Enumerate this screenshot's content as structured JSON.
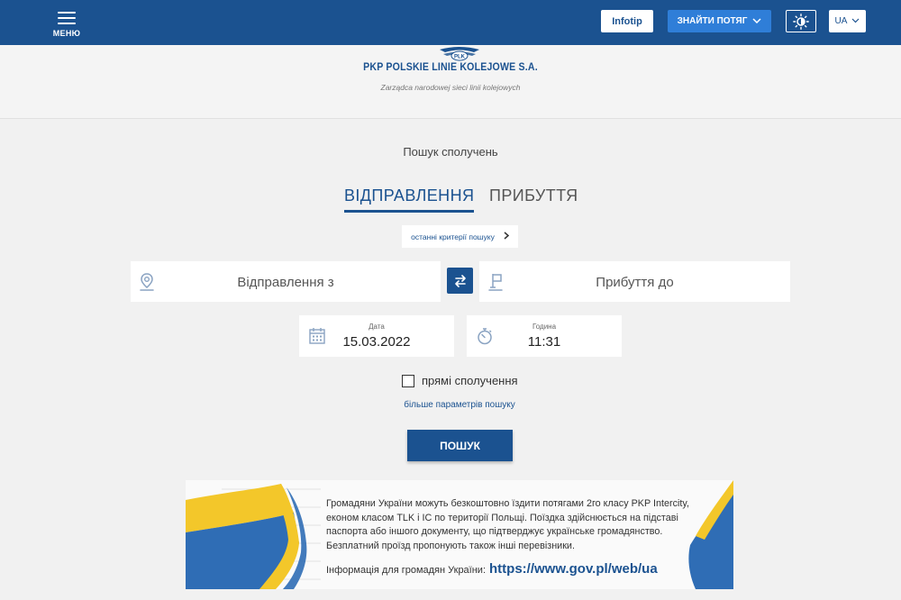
{
  "header": {
    "menu_label": "МЕНЮ",
    "infotip_label": "Infotip",
    "find_train_label": "ЗНАЙТИ ПОТЯГ",
    "lang_label": "UA"
  },
  "logo": {
    "mark_text": "PLK",
    "company_name": "PKP POLSKIE LINIE KOLEJOWE S.A.",
    "tagline": "Zarządca narodowej sieci linii kolejowych"
  },
  "search": {
    "title": "Пошук сполучень",
    "tabs": [
      {
        "label": "ВІДПРАВЛЕННЯ",
        "active": true
      },
      {
        "label": "ПРИБУТТЯ",
        "active": false
      }
    ],
    "recent_criteria_label": "останні критерії пошуку",
    "from_placeholder": "Відправлення з",
    "to_placeholder": "Прибуття до",
    "date_label": "Дата",
    "date_value": "15.03.2022",
    "time_label": "Година",
    "time_value": "11:31",
    "direct_label": "прямі сполучення",
    "direct_checked": false,
    "more_params_label": "більше параметрів пошуку",
    "search_button_label": "ПОШУК"
  },
  "banner": {
    "text": "Громадяни України можуть безкоштовно їздити потягами 2го класу PKP Intercity, економ класом TLK і IC по території Польщі. Поїздка здійснюється на підставі паспорта або іншого документу, що підтверджує українське громадянство. Безплатний проїзд пропонують також інші перевізники.",
    "info_label": "Інформація для громадян України:",
    "info_url": "https://www.gov.pl/web/ua"
  },
  "colors": {
    "brand_blue": "#1b5290",
    "accent_blue": "#2f7ed8",
    "flag_blue": "#2f6db5",
    "flag_yellow": "#f3c72a"
  },
  "icons": [
    "menu-icon",
    "chevron-down-icon",
    "contrast-icon",
    "location-pin-icon",
    "swap-icon",
    "destination-flag-icon",
    "calendar-icon",
    "stopwatch-icon",
    "chevron-right-icon"
  ]
}
